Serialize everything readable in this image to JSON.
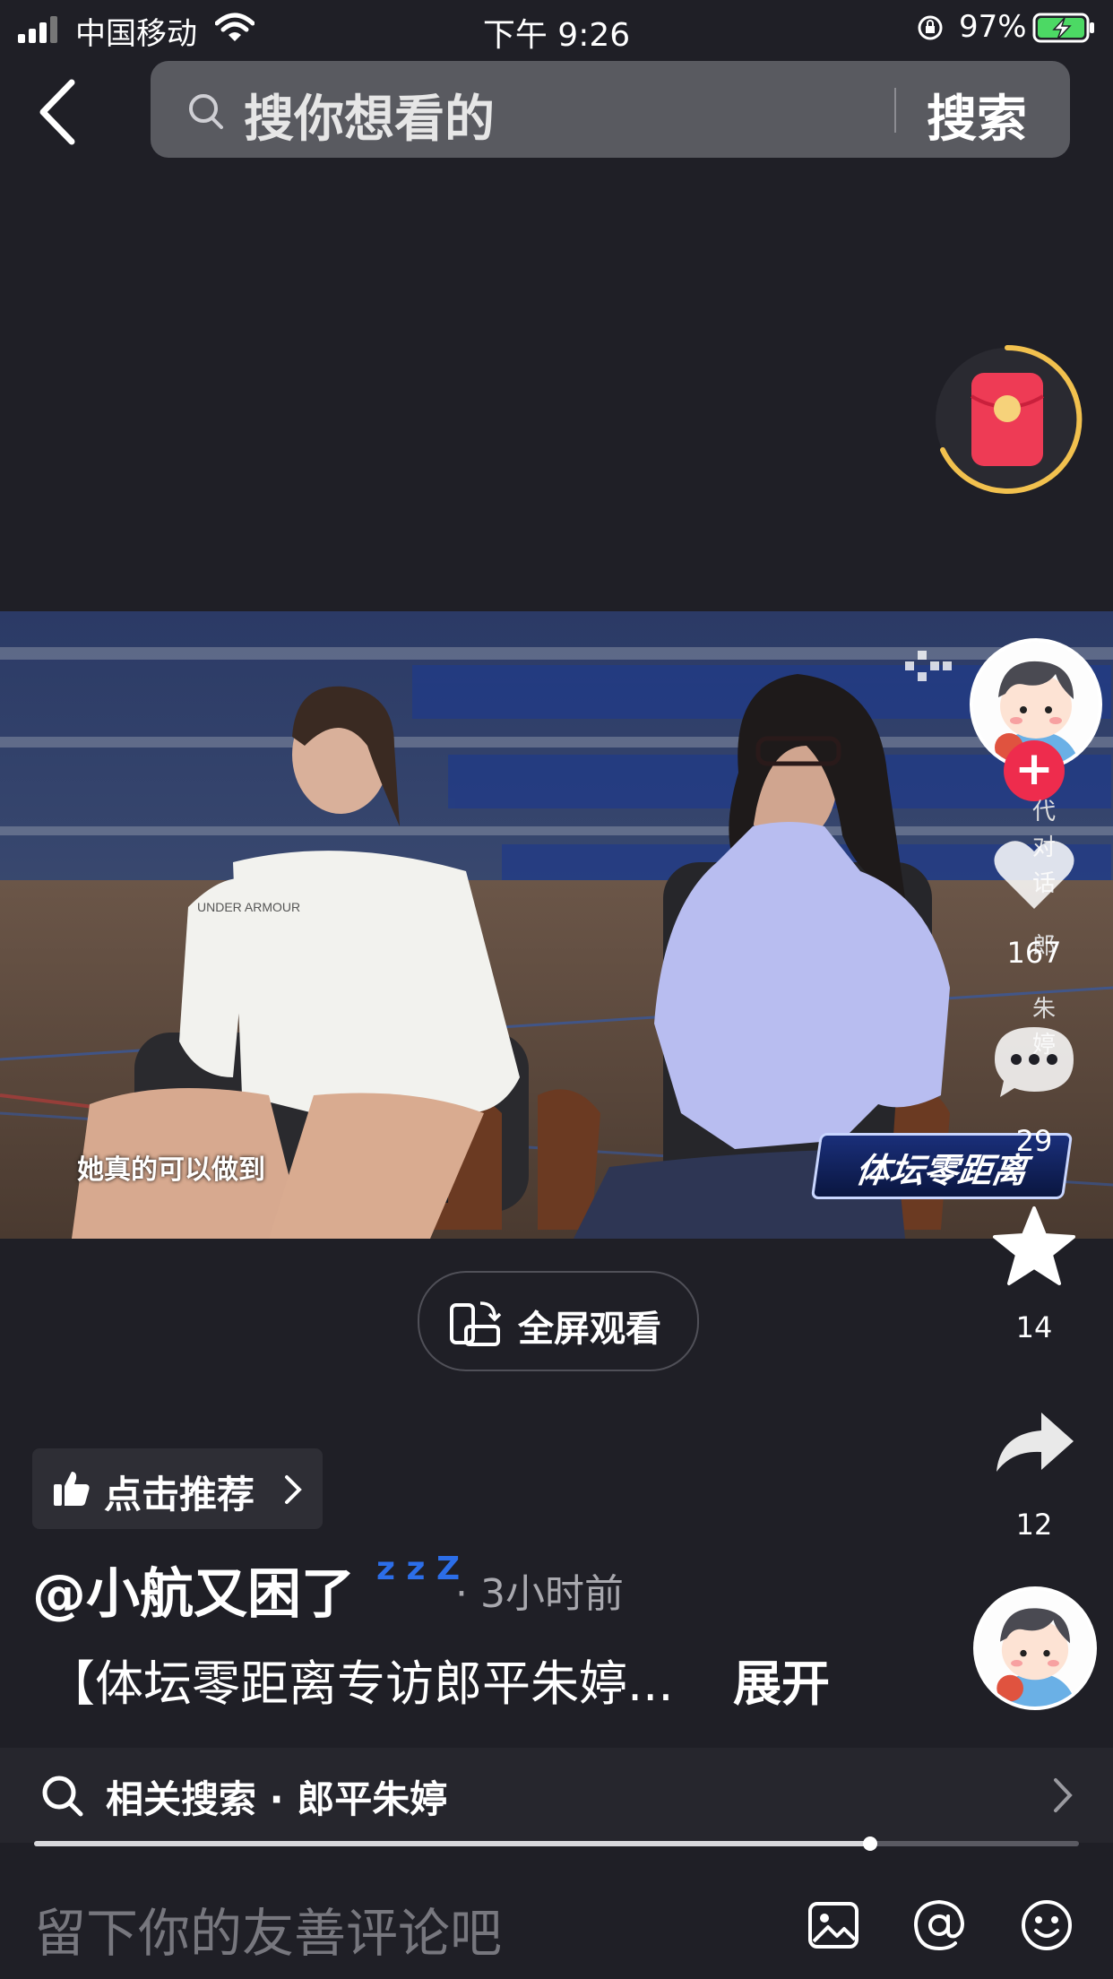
{
  "status_bar": {
    "carrier": "中国移动",
    "time": "下午 9:26",
    "battery": "97%"
  },
  "search": {
    "placeholder": "搜你想看的",
    "button": "搜索"
  },
  "video": {
    "subtitle": "她真的可以做到",
    "show_logo": "体坛零距离",
    "jersey_text": "UNDER ARMOUR",
    "fullscreen_label": "全屏观看"
  },
  "actions": {
    "follow": "+",
    "side_text": [
      "代",
      "对",
      "话",
      "郎",
      "朱",
      "婷"
    ],
    "likes": "167",
    "comments": "29",
    "favorites": "14",
    "shares": "12"
  },
  "post": {
    "recommend_label": "点击推荐",
    "author": "@小航又困了",
    "zzz": "z z Z",
    "time": "· 3小时前",
    "description": "【体坛零距离专访郎平朱婷...",
    "expand": "展开"
  },
  "related_search": {
    "label": "相关搜索 · 郎平朱婷"
  },
  "playback": {
    "progress": 0.8
  },
  "comment": {
    "placeholder": "留下你的友善评论吧"
  },
  "colors": {
    "background": "#1f1f26",
    "accent_red": "#ee2c4d",
    "ring_gold": "#f2c14e",
    "battery_green": "#4cd964"
  }
}
